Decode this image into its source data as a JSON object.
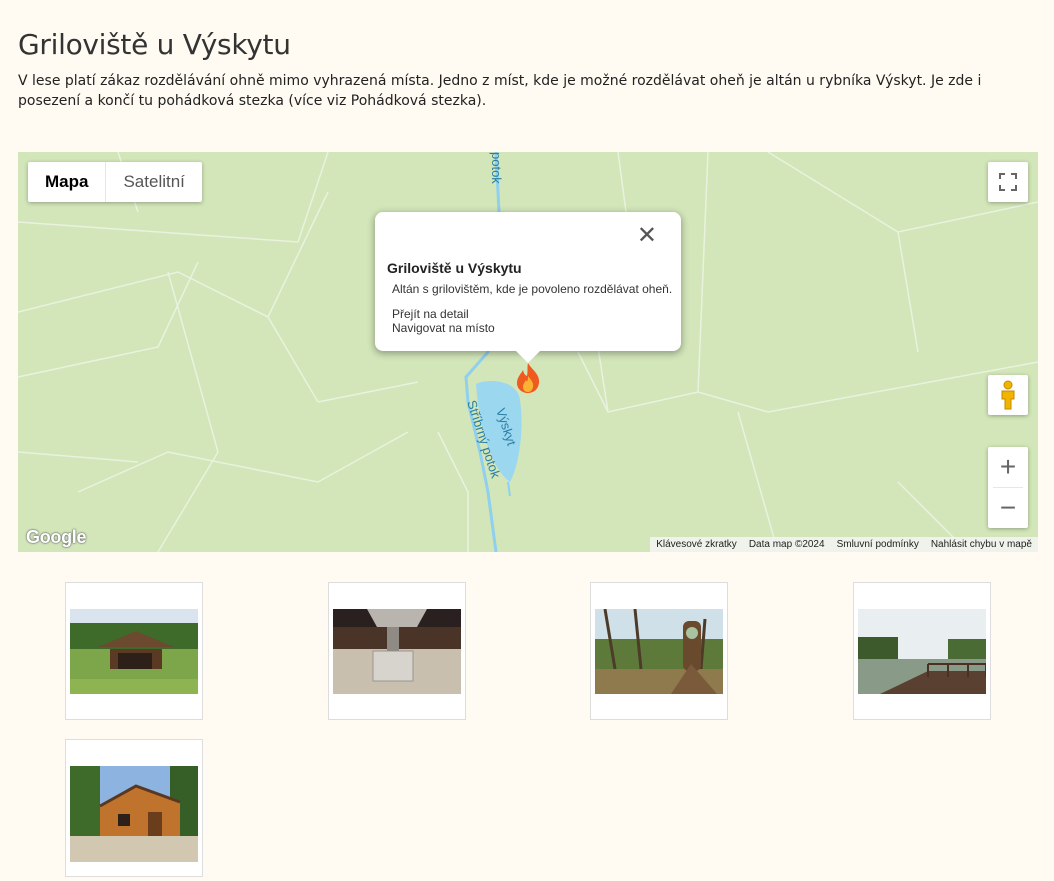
{
  "page": {
    "title": "Griloviště u Výskytu",
    "intro_text": "V lese platí zákaz rozdělávání ohně mimo vyhrazená místa. Jedno z míst, kde je možné rozdělávat oheň je altán u rybníka Výskyt. Je zde i posezení a končí tu pohádková stezka (více viz ",
    "intro_link": "Pohádková stezka",
    "intro_tail": ")."
  },
  "map": {
    "map_type_options": [
      "Mapa",
      "Satelitní"
    ],
    "selected_map_type": "Mapa",
    "labels": {
      "stream_top": "potok",
      "stream_main": "Stříbrný potok",
      "pond": "Výskyt"
    },
    "google_logo": "Google",
    "attribution": [
      "Klávesové zkratky",
      "Data map ©2024",
      "Smluvní podmínky",
      "Nahlásit chybu v mapě"
    ],
    "zoom_in": "+",
    "zoom_out": "−",
    "colors": {
      "land": "#d2e6b9",
      "water": "#9cd7f0",
      "stream": "#8fd0ee"
    },
    "info_window": {
      "title": "Griloviště u Výskytu",
      "description": "Altán s grilovištěm, kde je povoleno rozdělávat oheň.",
      "link_detail": "Přejít na detail",
      "link_navigate": "Navigovat na místo",
      "close_icon": "close-icon"
    },
    "marker_icon": "fire-icon"
  },
  "gallery": {
    "photos": [
      {
        "subject": "wooden gazebo in forest"
      },
      {
        "subject": "stone grill under roof"
      },
      {
        "subject": "carved wooden figure by pond"
      },
      {
        "subject": "wooden pier on pond"
      },
      {
        "subject": "wooden cabin"
      }
    ]
  }
}
